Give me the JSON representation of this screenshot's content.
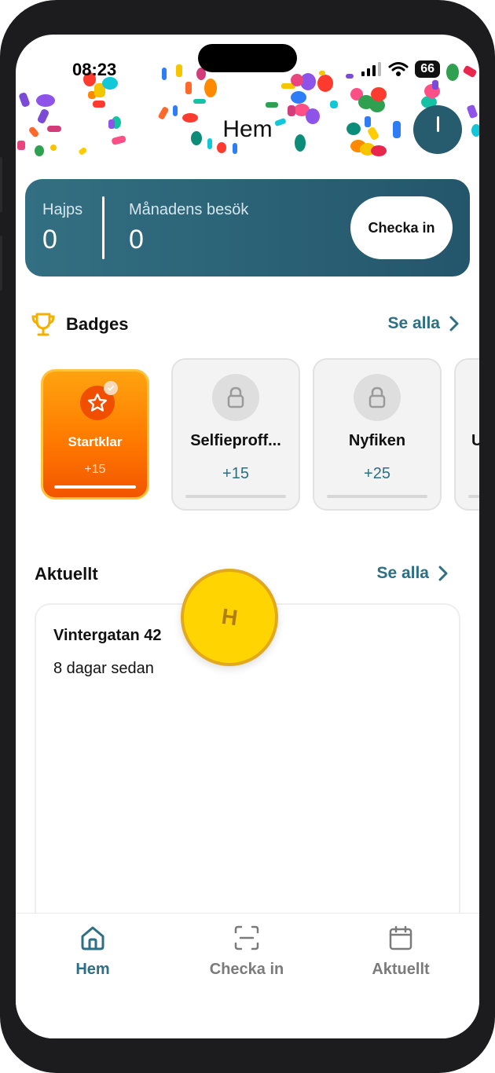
{
  "status_bar": {
    "time": "08:23",
    "battery": "66"
  },
  "header": {
    "title": "Hem"
  },
  "stats": {
    "hype_label": "Hajps",
    "hype_value": "0",
    "visits_label": "Månadens besök",
    "visits_value": "0",
    "checkin_label": "Checka in"
  },
  "badges": {
    "title": "Badges",
    "see_all": "Se alla",
    "items": [
      {
        "name": "Startklar",
        "points": "+15",
        "state": "unlocked"
      },
      {
        "name": "Selfieproff...",
        "points": "+15",
        "state": "locked"
      },
      {
        "name": "Nyfiken",
        "points": "+25",
        "state": "locked"
      },
      {
        "name": "U",
        "state": "locked"
      }
    ]
  },
  "news": {
    "title": "Aktuellt",
    "see_all": "Se alla",
    "items": [
      {
        "title": "Vintergatan 42",
        "date": "8 dagar sedan"
      }
    ]
  },
  "coin": {
    "letter": "H"
  },
  "tabs": [
    {
      "label": "Hem",
      "icon": "home-icon",
      "active": true
    },
    {
      "label": "Checka in",
      "icon": "scan-icon",
      "active": false
    },
    {
      "label": "Aktuellt",
      "icon": "calendar-icon",
      "active": false
    }
  ],
  "colors": {
    "accent": "#2d6f84",
    "card_start": "#336f82",
    "card_end": "#24566b",
    "badge_orange": "#ff7a00",
    "coin_yellow": "#ffd400",
    "inactive_tab": "#7b7b7b"
  }
}
